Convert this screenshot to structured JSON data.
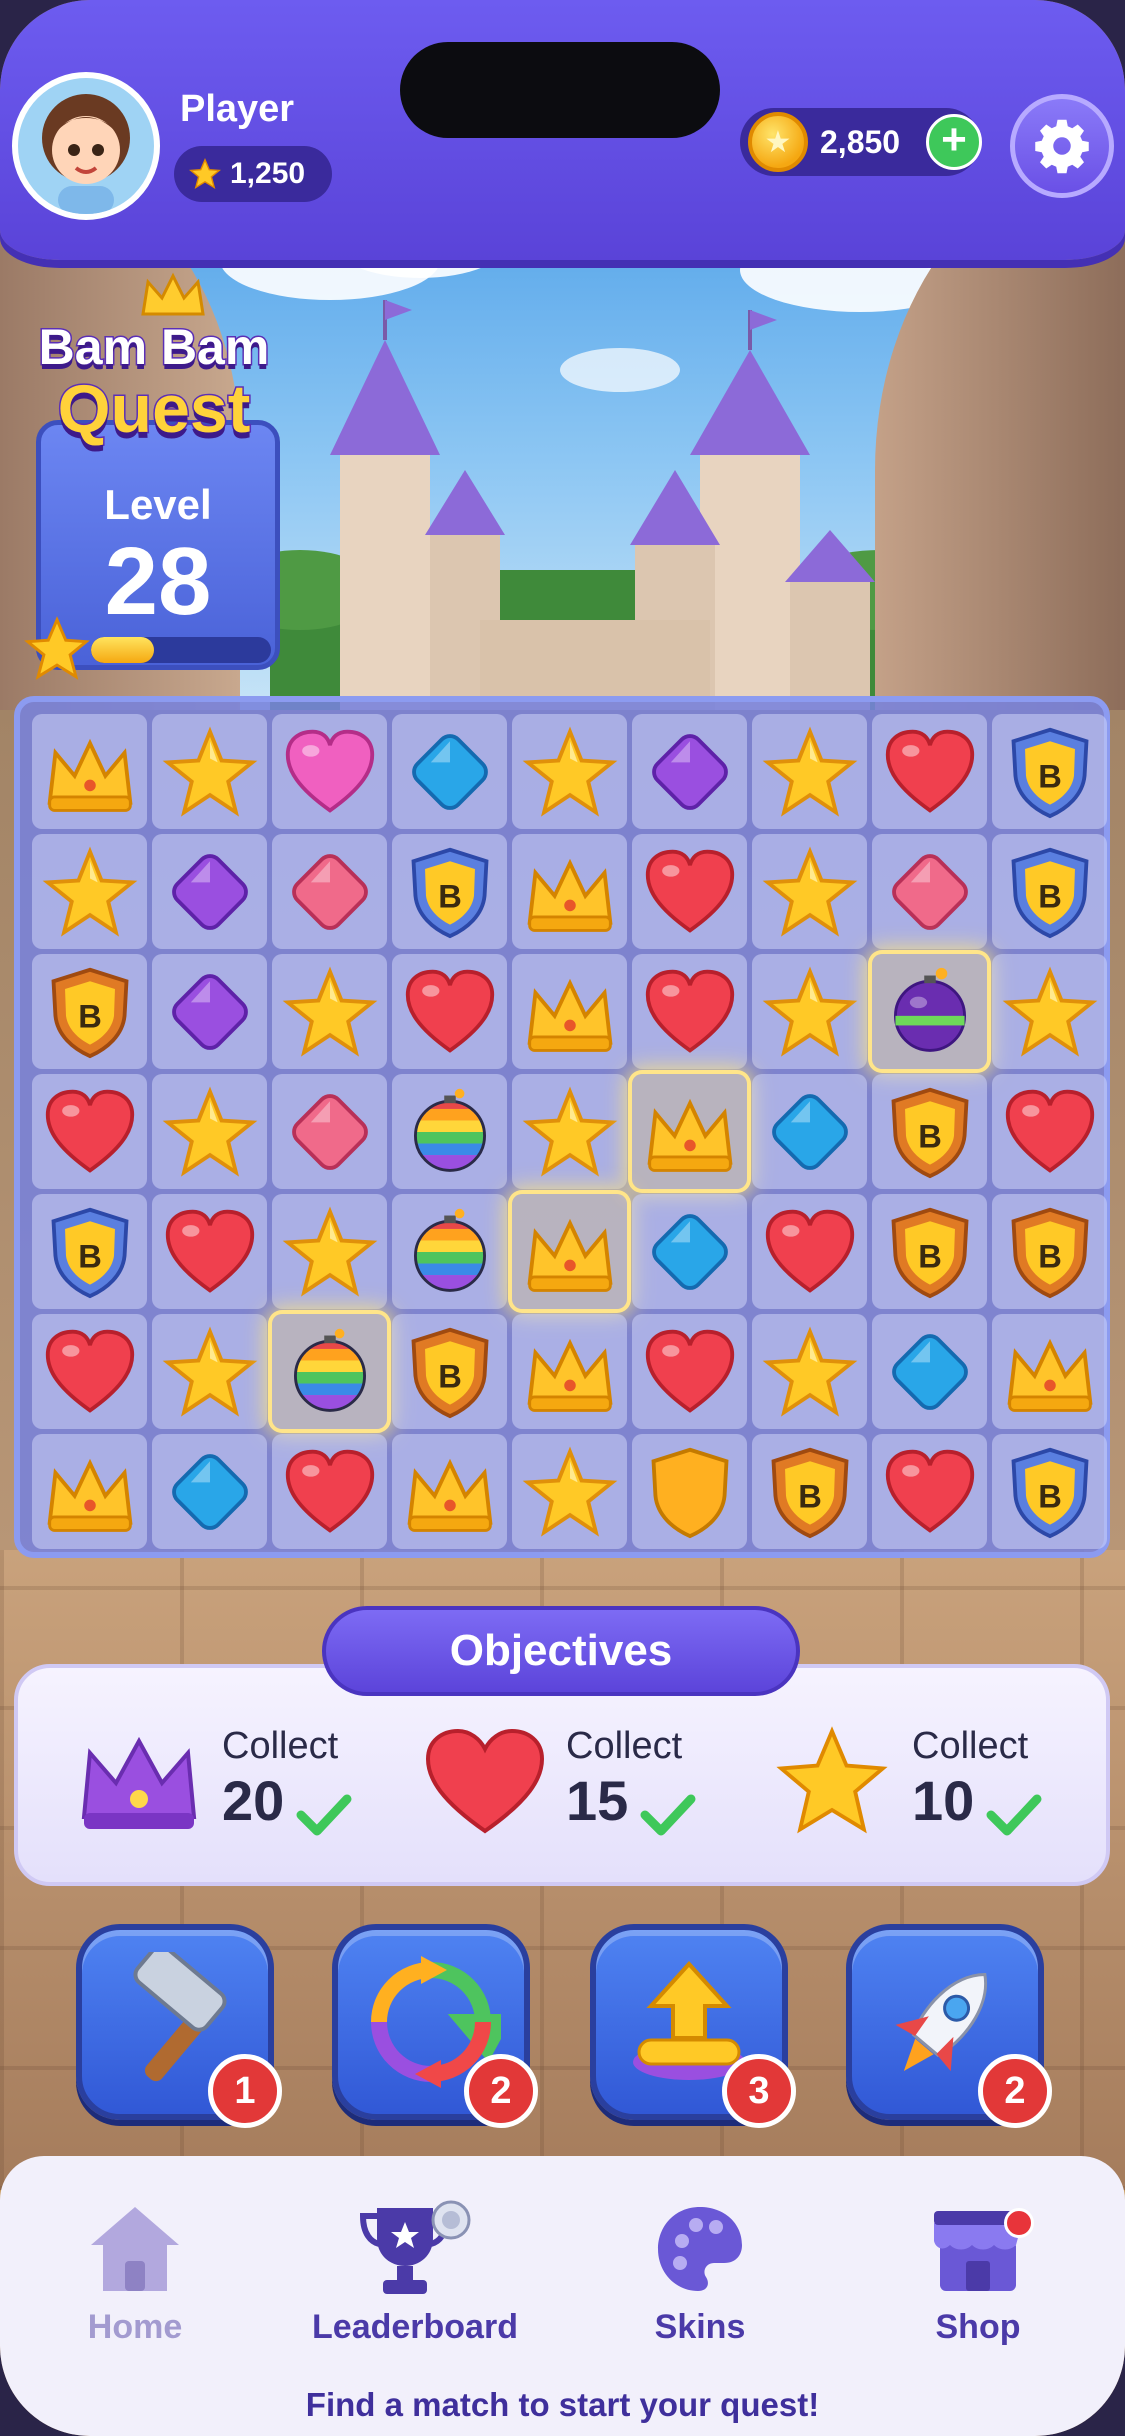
{
  "player": {
    "name": "Player",
    "stars": "1,250"
  },
  "currency": {
    "coins": "2,850",
    "add_label": "+"
  },
  "title": {
    "line1": "Bam Bam",
    "line2": "Quest"
  },
  "level": {
    "label": "Level",
    "number": "28",
    "progress": 0.35
  },
  "board": {
    "rows": [
      [
        "crown",
        "star",
        "heart-pink",
        "diamond-blue",
        "star",
        "diamond-purple",
        "star",
        "heart",
        "shield-blue"
      ],
      [
        "star",
        "diamond-purple",
        "diamond-pink",
        "shield-blue",
        "crown",
        "heart",
        "star",
        "diamond-pink",
        "shield-blue"
      ],
      [
        "shield-orange",
        "diamond-purple",
        "star",
        "heart",
        "crown",
        "heart",
        "star",
        "bomb-purple",
        "star"
      ],
      [
        "heart",
        "star",
        "diamond-pink",
        "bomb-rainbow",
        "star",
        "crown",
        "diamond-blue",
        "shield-orange",
        "heart"
      ],
      [
        "shield-blue",
        "heart",
        "star",
        "bomb-rainbow",
        "crown",
        "diamond-blue",
        "heart",
        "shield-orange",
        "shield-orange"
      ],
      [
        "heart",
        "star",
        "bomb-rainbow",
        "shield-orange",
        "crown",
        "heart",
        "star",
        "diamond-blue",
        "crown"
      ],
      [
        "crown",
        "diamond-blue",
        "heart",
        "crown",
        "star",
        "shield-plain",
        "shield-orange",
        "heart",
        "shield-blue"
      ]
    ],
    "highlighted": [
      [
        2,
        7
      ],
      [
        3,
        5
      ],
      [
        4,
        4
      ],
      [
        5,
        2
      ]
    ],
    "shield_letter": "B"
  },
  "objectives": {
    "title": "Objectives",
    "items": [
      {
        "icon": "crown-purple-icon",
        "label": "Collect",
        "count": "20",
        "done": true
      },
      {
        "icon": "heart-icon",
        "label": "Collect",
        "count": "15",
        "done": true
      },
      {
        "icon": "star-icon",
        "label": "Collect",
        "count": "10",
        "done": true
      }
    ]
  },
  "boosters": [
    {
      "icon": "hammer-icon",
      "count": "1"
    },
    {
      "icon": "shuffle-icon",
      "count": "2"
    },
    {
      "icon": "upgrade-icon",
      "count": "3"
    },
    {
      "icon": "rocket-icon",
      "count": "2"
    }
  ],
  "nav": {
    "items": [
      {
        "label": "Home",
        "icon": "home-icon",
        "active": false
      },
      {
        "label": "Leaderboard",
        "icon": "trophy-icon",
        "active": true
      },
      {
        "label": "Skins",
        "icon": "palette-icon",
        "active": true
      },
      {
        "label": "Shop",
        "icon": "shop-icon",
        "active": true
      }
    ],
    "hint": "Find a match to start your quest!"
  },
  "colors": {
    "header": "#5a43d8",
    "accent_gold": "#ffd23a",
    "nav_text": "#4b3aa8",
    "badge_red": "#e23838",
    "check_green": "#3ec85a"
  }
}
